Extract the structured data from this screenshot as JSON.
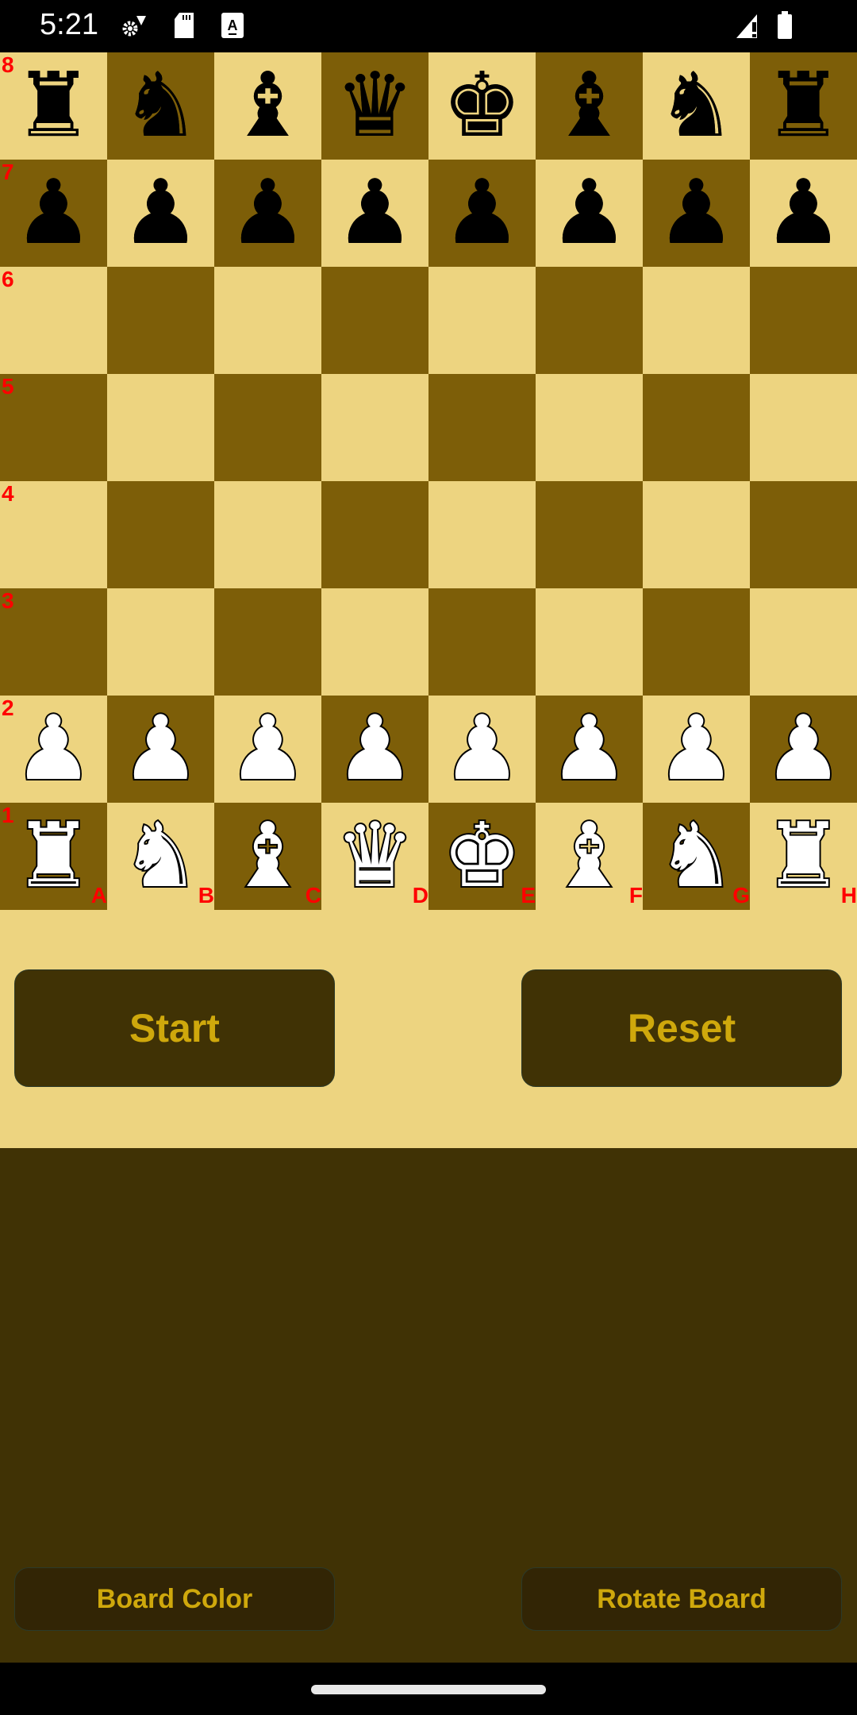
{
  "status_bar": {
    "time": "5:21",
    "left_icons": [
      "settings-sync-icon",
      "sd-card-icon",
      "text-a-icon"
    ],
    "right_icons": [
      "signal-no-data-icon",
      "battery-icon"
    ]
  },
  "colors": {
    "light_square": "#EDD480",
    "dark_square": "#7D5E08",
    "label": "#FF0000",
    "button_bg": "#403205",
    "button_text": "#CFA80C",
    "panel_bg": "#403205"
  },
  "board": {
    "ranks": [
      "8",
      "7",
      "6",
      "5",
      "4",
      "3",
      "2",
      "1"
    ],
    "files": [
      "A",
      "B",
      "C",
      "D",
      "E",
      "F",
      "G",
      "H"
    ],
    "position": [
      [
        "bR",
        "bN",
        "bB",
        "bQ",
        "bK",
        "bB",
        "bN",
        "bR"
      ],
      [
        "bP",
        "bP",
        "bP",
        "bP",
        "bP",
        "bP",
        "bP",
        "bP"
      ],
      [
        "",
        "",
        "",
        "",
        "",
        "",
        "",
        ""
      ],
      [
        "",
        "",
        "",
        "",
        "",
        "",
        "",
        ""
      ],
      [
        "",
        "",
        "",
        "",
        "",
        "",
        "",
        ""
      ],
      [
        "",
        "",
        "",
        "",
        "",
        "",
        "",
        ""
      ],
      [
        "wP",
        "wP",
        "wP",
        "wP",
        "wP",
        "wP",
        "wP",
        "wP"
      ],
      [
        "wR",
        "wN",
        "wB",
        "wQ",
        "wK",
        "wB",
        "wN",
        "wR"
      ]
    ]
  },
  "controls": {
    "start_label": "Start",
    "reset_label": "Reset",
    "board_color_label": "Board Color",
    "rotate_board_label": "Rotate Board"
  }
}
